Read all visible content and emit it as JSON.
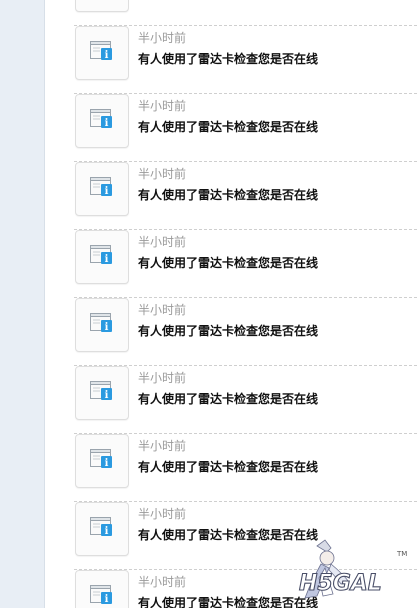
{
  "notifications": {
    "icon": "info-window-icon",
    "items": [
      {
        "time": "",
        "message": ""
      },
      {
        "time": "半小时前",
        "message": "有人使用了雷达卡检查您是否在线"
      },
      {
        "time": "半小时前",
        "message": "有人使用了雷达卡检查您是否在线"
      },
      {
        "time": "半小时前",
        "message": "有人使用了雷达卡检查您是否在线"
      },
      {
        "time": "半小时前",
        "message": "有人使用了雷达卡检查您是否在线"
      },
      {
        "time": "半小时前",
        "message": "有人使用了雷达卡检查您是否在线"
      },
      {
        "time": "半小时前",
        "message": "有人使用了雷达卡检查您是否在线"
      },
      {
        "time": "半小时前",
        "message": "有人使用了雷达卡检查您是否在线"
      },
      {
        "time": "半小时前",
        "message": "有人使用了雷达卡检查您是否在线"
      },
      {
        "time": "半小时前",
        "message": "有人使用了雷达卡检查您是否在线"
      }
    ]
  },
  "watermark": {
    "text": "H5GAL",
    "tm": "TM"
  },
  "colors": {
    "rail": "#e8eef5",
    "time_text": "#9a9a9a",
    "message_text": "#111111",
    "icon_blue": "#2b9ae0"
  }
}
